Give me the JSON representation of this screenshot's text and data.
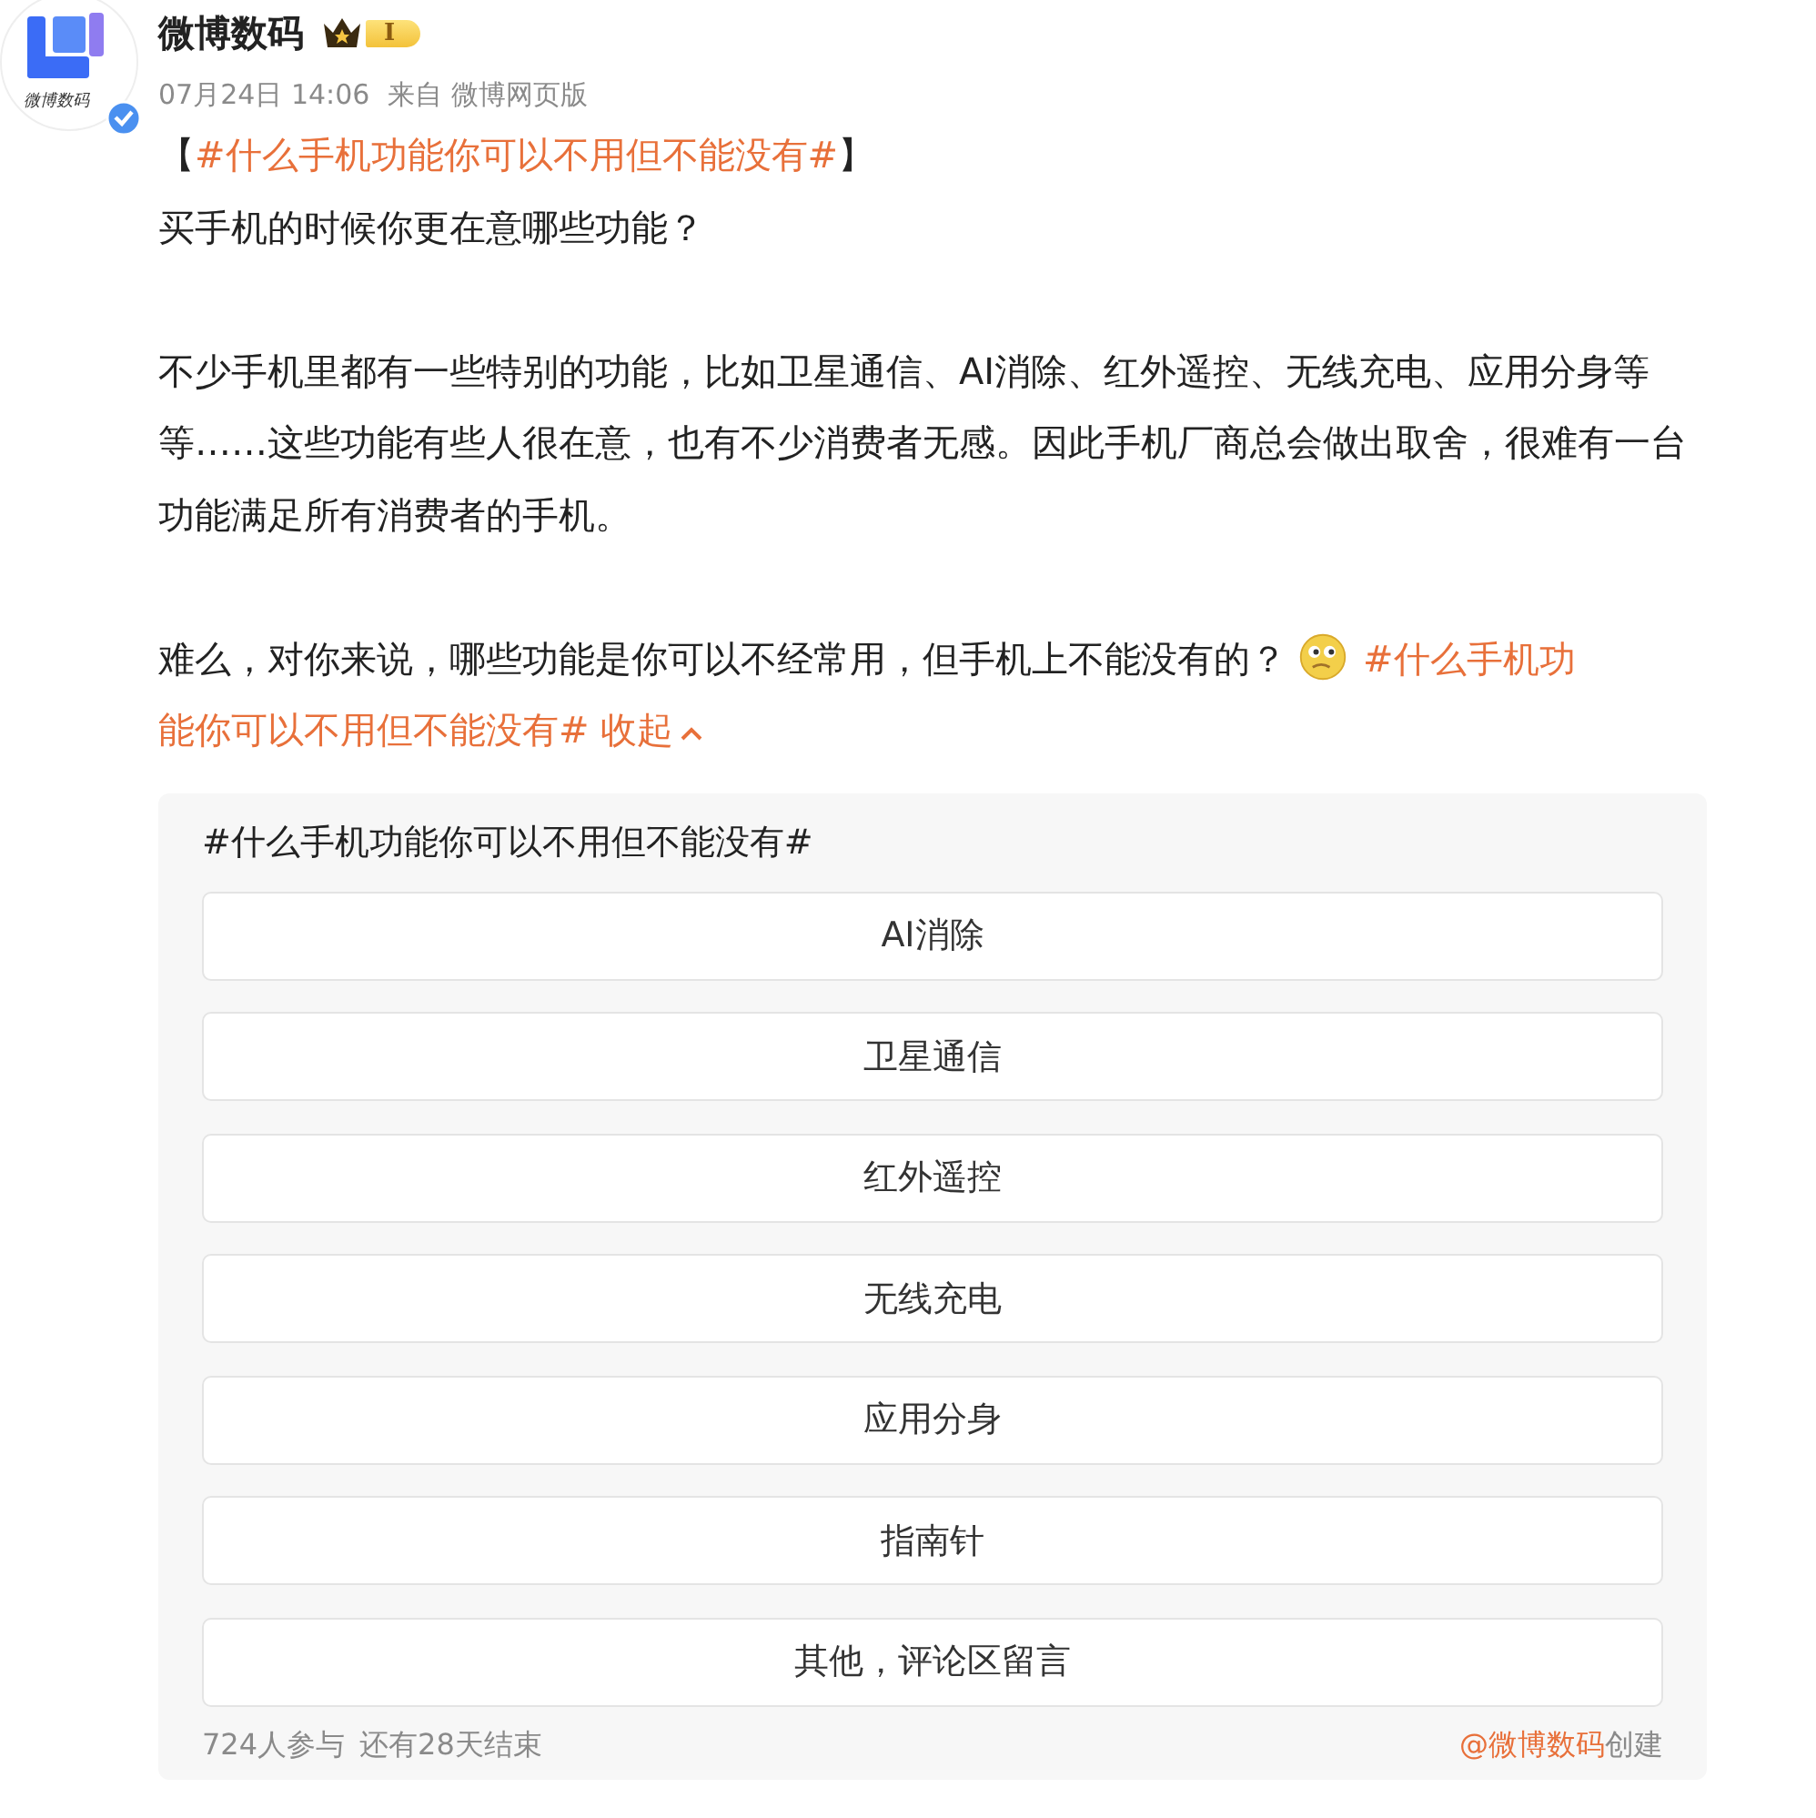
{
  "author": {
    "name": "微博数码",
    "avatar_text": "微博数码",
    "verified": true,
    "badge": "I"
  },
  "meta": {
    "time": "07月24日 14:06",
    "source": "来自 微博网页版"
  },
  "headline": [
    {
      "kind": "text",
      "text": "【"
    },
    {
      "kind": "topic",
      "text": "#什么手机功能你可以不用但不能没有#"
    },
    {
      "kind": "text",
      "text": "】"
    }
  ],
  "paragraphs": [
    [
      {
        "kind": "text",
        "text": "买手机的时候你更在意哪些功能？"
      }
    ],
    [
      {
        "kind": "text",
        "text": "不少手机里都有一些特别的功能，比如卫星通信、AI消除、红外遥控、无线充电、应用分身等等……这些功能有些人很在意，也有不少消费者无感。因此手机厂商总会做出取舍，很难有一台功能满足所有消费者的手机。"
      }
    ],
    [
      {
        "kind": "text",
        "text": "难么，对你来说，哪些功能是你可以不经常用，但手机上不能没有的？"
      },
      {
        "kind": "emoji"
      },
      {
        "kind": "topic",
        "text": "#什么手机功"
      },
      {
        "kind": "topic",
        "text": "能你可以不用但不能没有#"
      },
      {
        "kind": "toggle",
        "text": "收起"
      }
    ]
  ],
  "poll": {
    "title": "#什么手机功能你可以不用但不能没有#",
    "options": [
      "AI消除",
      "卫星通信",
      "红外遥控",
      "无线充电",
      "应用分身",
      "指南针",
      "其他，评论区留言"
    ],
    "participants": "724人参与",
    "remaining": "还有28天结束",
    "creator": "@微博数码",
    "created": "创建"
  }
}
